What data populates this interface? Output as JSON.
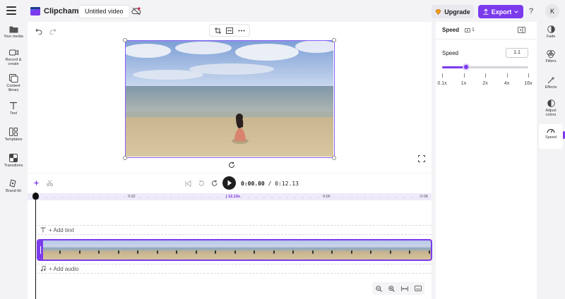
{
  "topbar": {
    "app_name": "Clipchamp",
    "project_title": "Untitled video",
    "upgrade_label": "Upgrade",
    "export_label": "Export",
    "help_label": "?",
    "avatar_initial": "K"
  },
  "left_nav": {
    "items": [
      {
        "label": "Your media",
        "icon": "folder-icon"
      },
      {
        "label": "Record & create",
        "icon": "camera-icon"
      },
      {
        "label": "Content library",
        "icon": "library-icon"
      },
      {
        "label": "Text",
        "icon": "text-icon"
      },
      {
        "label": "Templates",
        "icon": "templates-icon"
      },
      {
        "label": "Transitions",
        "icon": "transitions-icon"
      },
      {
        "label": "Brand kit",
        "icon": "brand-kit-icon"
      }
    ]
  },
  "timeline": {
    "current_time": "0:00.00",
    "total_time": "/ 0:12.13",
    "ruler_ticks": [
      "0:02",
      "12.13s",
      "0:06",
      "0:08"
    ],
    "add_text_label": "+ Add text",
    "add_audio_label": "+ Add audio"
  },
  "speed_panel": {
    "title": "Speed",
    "badge_count": "1",
    "speed_label": "Speed",
    "speed_value": "1.1",
    "slider_fraction": 0.28,
    "tick_labels": [
      "0.1x",
      "1x",
      "2x",
      "4x",
      "16x"
    ]
  },
  "right_nav": {
    "items": [
      {
        "label": "Fade",
        "icon": "fade-icon"
      },
      {
        "label": "Filters",
        "icon": "filters-icon"
      },
      {
        "label": "Effects",
        "icon": "effects-icon"
      },
      {
        "label": "Adjust colors",
        "icon": "adjust-colors-icon"
      },
      {
        "label": "Speed",
        "icon": "speed-icon"
      }
    ]
  },
  "colors": {
    "accent": "#7c3aed",
    "background": "#f3f3f6"
  }
}
